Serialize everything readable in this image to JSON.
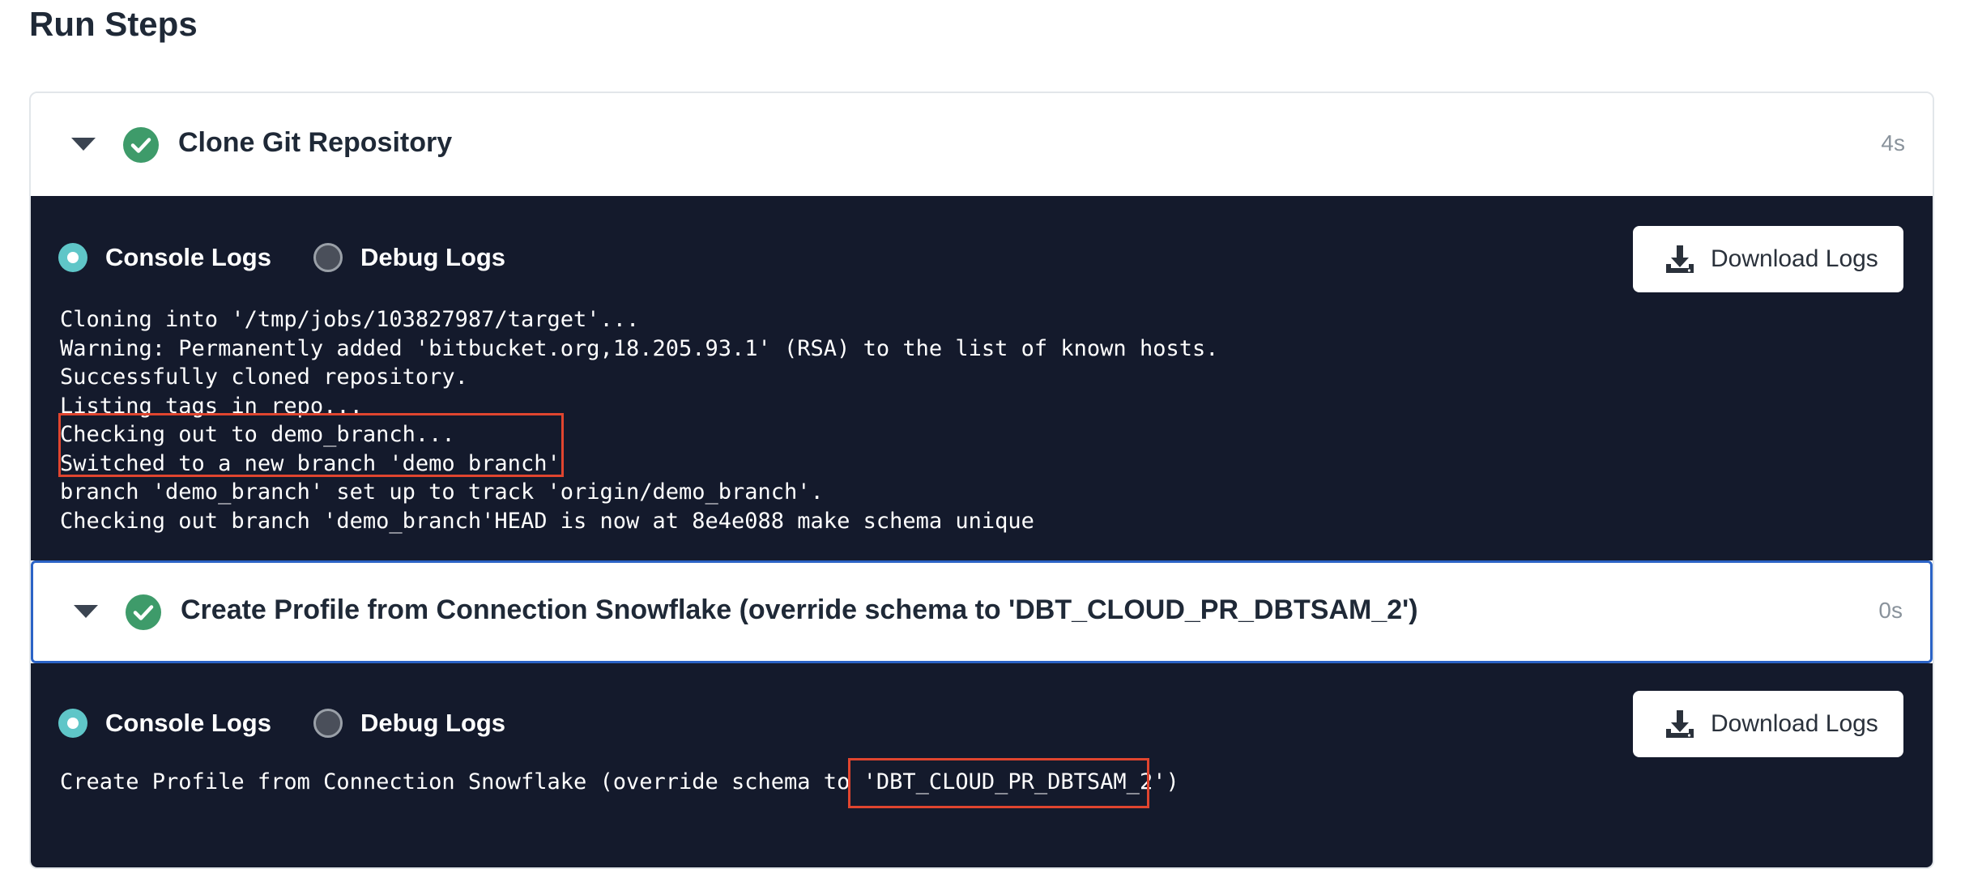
{
  "page": {
    "title": "Run Steps"
  },
  "steps": [
    {
      "title": "Clone Git Repository",
      "duration": "4s",
      "status": "success",
      "log_tabs": {
        "console": "Console Logs",
        "debug": "Debug Logs",
        "selected": "console"
      },
      "download_label": "Download Logs",
      "log_lines": [
        "Cloning into '/tmp/jobs/103827987/target'...",
        "Warning: Permanently added 'bitbucket.org,18.205.93.1' (RSA) to the list of known hosts.",
        "Successfully cloned repository.",
        "Listing tags in repo...",
        "Checking out to demo_branch...",
        "Switched to a new branch 'demo_branch'",
        "branch 'demo_branch' set up to track 'origin/demo_branch'.",
        "Checking out branch 'demo_branch'HEAD is now at 8e4e088 make schema unique"
      ]
    },
    {
      "title": "Create Profile from Connection Snowflake (override schema to 'DBT_CLOUD_PR_DBTSAM_2')",
      "duration": "0s",
      "status": "success",
      "log_tabs": {
        "console": "Console Logs",
        "debug": "Debug Logs",
        "selected": "console"
      },
      "download_label": "Download Logs",
      "log_lines": [
        "Create Profile from Connection Snowflake (override schema to 'DBT_CLOUD_PR_DBTSAM_2')"
      ]
    }
  ],
  "icons": {
    "expand": "chevron-down-icon",
    "status": "check-circle-icon",
    "download": "download-icon"
  },
  "colors": {
    "log_background": "#141a2c",
    "success": "#3e9b6a",
    "radio_selected": "#5fc6c8",
    "highlight": "#e0452f",
    "active_border": "#2b63c6"
  }
}
